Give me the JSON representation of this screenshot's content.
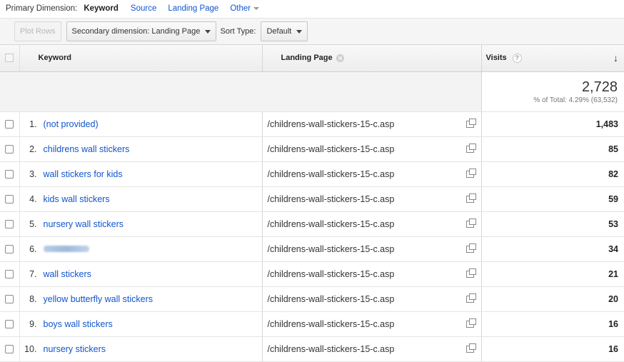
{
  "primary_dimension": {
    "label": "Primary Dimension:",
    "active": "Keyword",
    "links": [
      "Source",
      "Landing Page"
    ],
    "other": "Other"
  },
  "toolbar": {
    "plot_rows": "Plot Rows",
    "secondary_dimension": "Secondary dimension: Landing Page",
    "sort_type_label": "Sort Type:",
    "sort_type_value": "Default"
  },
  "table": {
    "headers": {
      "keyword": "Keyword",
      "landing_page": "Landing Page",
      "visits": "Visits",
      "sort_arrow": "↓",
      "help": "?"
    },
    "summary": {
      "total": "2,728",
      "percent_of_total": "% of Total: 4.29% (63,532)"
    },
    "rows": [
      {
        "index": "1.",
        "keyword": "(not provided)",
        "landing_page": "/childrens-wall-stickers-15-c.asp",
        "visits": "1,483"
      },
      {
        "index": "2.",
        "keyword": "childrens wall stickers",
        "landing_page": "/childrens-wall-stickers-15-c.asp",
        "visits": "85"
      },
      {
        "index": "3.",
        "keyword": "wall stickers for kids",
        "landing_page": "/childrens-wall-stickers-15-c.asp",
        "visits": "82"
      },
      {
        "index": "4.",
        "keyword": "kids wall stickers",
        "landing_page": "/childrens-wall-stickers-15-c.asp",
        "visits": "59"
      },
      {
        "index": "5.",
        "keyword": "nursery wall stickers",
        "landing_page": "/childrens-wall-stickers-15-c.asp",
        "visits": "53"
      },
      {
        "index": "6.",
        "keyword": "",
        "landing_page": "/childrens-wall-stickers-15-c.asp",
        "visits": "34",
        "blurred": true
      },
      {
        "index": "7.",
        "keyword": "wall stickers",
        "landing_page": "/childrens-wall-stickers-15-c.asp",
        "visits": "21"
      },
      {
        "index": "8.",
        "keyword": "yellow butterfly wall stickers",
        "landing_page": "/childrens-wall-stickers-15-c.asp",
        "visits": "20"
      },
      {
        "index": "9.",
        "keyword": "boys wall stickers",
        "landing_page": "/childrens-wall-stickers-15-c.asp",
        "visits": "16"
      },
      {
        "index": "10.",
        "keyword": "nursery stickers",
        "landing_page": "/childrens-wall-stickers-15-c.asp",
        "visits": "16"
      }
    ]
  },
  "colors": {
    "link": "#1155cc",
    "header_bg": "#efefef",
    "summary_bg": "#f3f3f3"
  },
  "icons": [
    "chevron-down-icon",
    "remove-dimension-icon",
    "help-icon",
    "sort-descending-icon",
    "open-external-icon",
    "checkbox-icon"
  ]
}
